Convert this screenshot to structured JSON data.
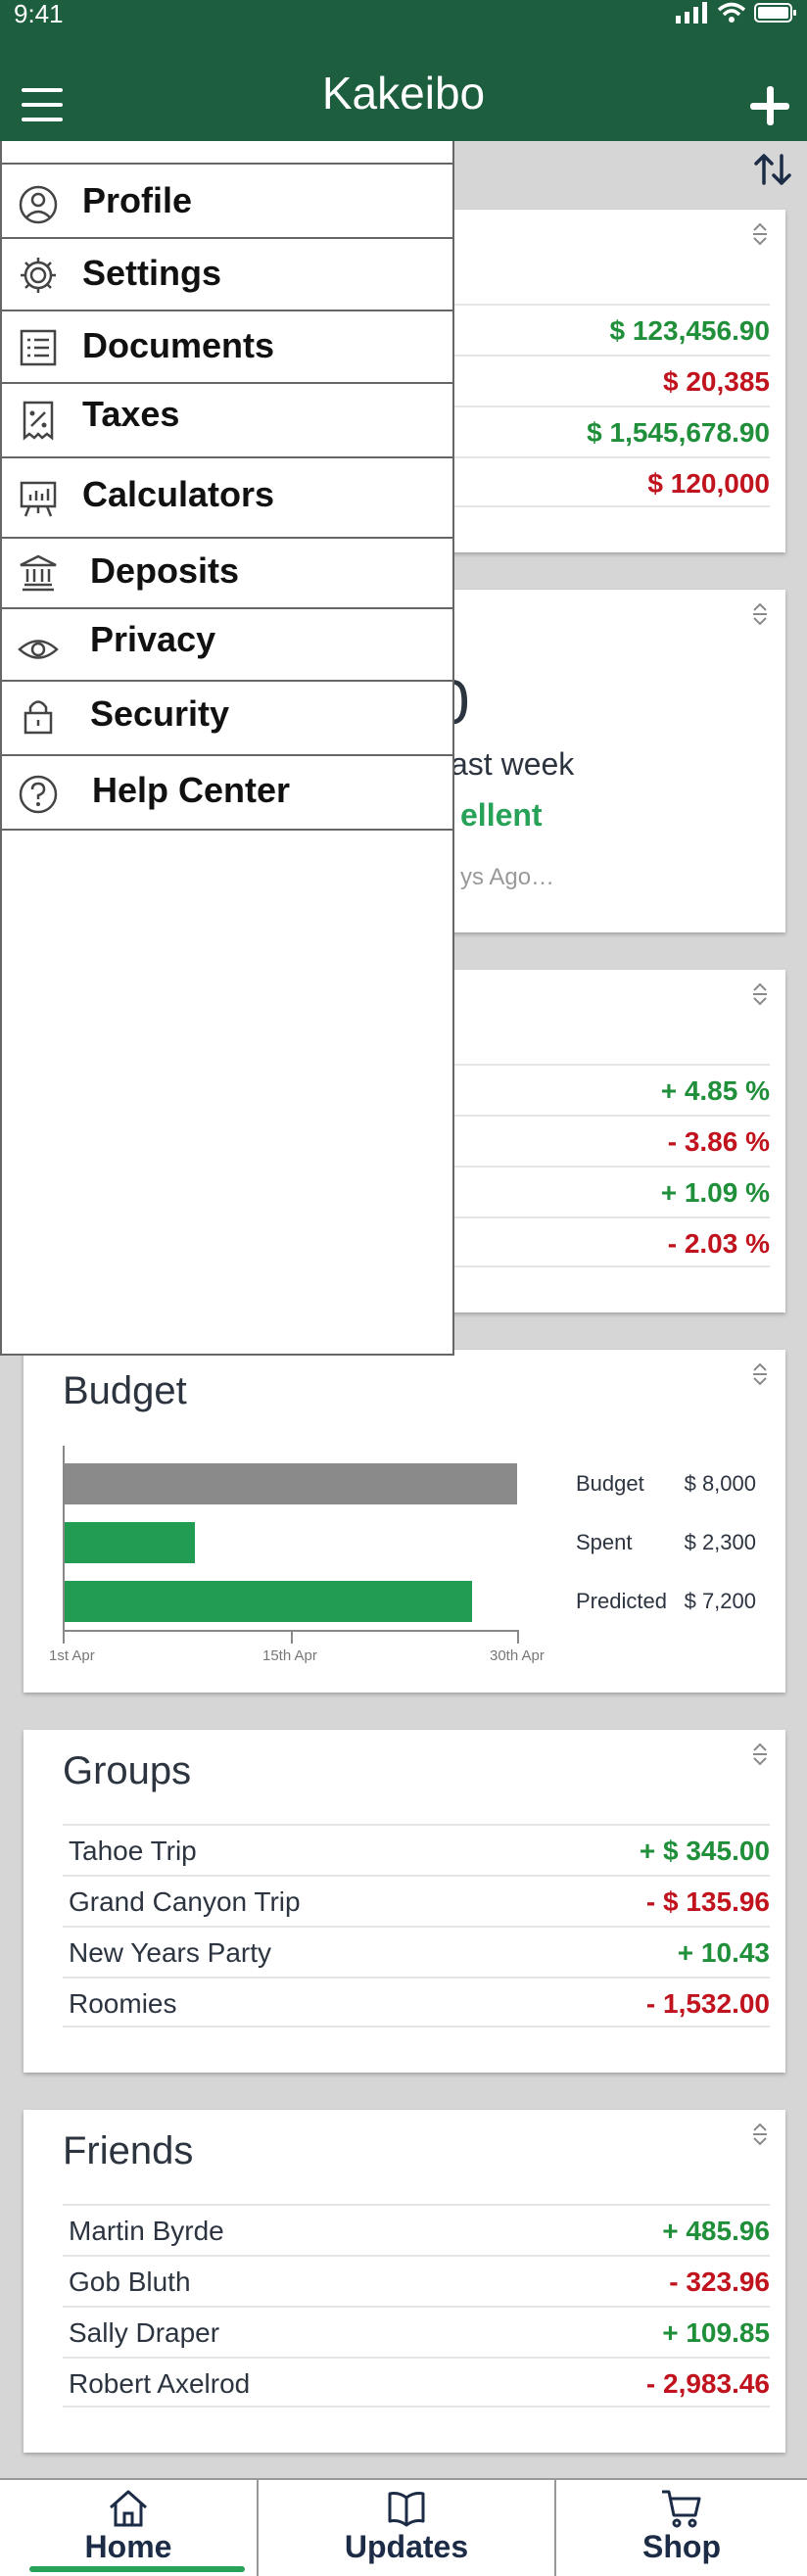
{
  "status_bar": {
    "time": "9:41"
  },
  "header": {
    "title": "Kakeibo"
  },
  "menu": {
    "items": [
      {
        "label": "Profile",
        "icon": "user-circle-icon"
      },
      {
        "label": "Settings",
        "icon": "gear-icon"
      },
      {
        "label": "Documents",
        "icon": "list-document-icon"
      },
      {
        "label": "Taxes",
        "icon": "receipt-percent-icon"
      },
      {
        "label": "Calculators",
        "icon": "chart-board-icon"
      },
      {
        "label": "Deposits",
        "icon": "bank-icon"
      },
      {
        "label": "Privacy",
        "icon": "eye-icon"
      },
      {
        "label": "Security",
        "icon": "lock-icon"
      },
      {
        "label": "Help Center",
        "icon": "question-circle-icon"
      }
    ]
  },
  "accounts_card": {
    "values": [
      "$ 123,456.90",
      "$ 20,385",
      "$ 1,545,678.90",
      "$ 120,000"
    ]
  },
  "score_card": {
    "partial_digit": "0",
    "partial_week": "ast week",
    "partial_rating": "ellent",
    "partial_time": "ys Ago…"
  },
  "markets_card": {
    "values": [
      "+ 4.85 %",
      "- 3.86 %",
      "+ 1.09 %",
      "- 2.03 %"
    ]
  },
  "budget_card": {
    "title": "Budget",
    "legend": [
      {
        "label": "Budget",
        "value": "$ 8,000"
      },
      {
        "label": "Spent",
        "value": "$ 2,300"
      },
      {
        "label": "Predicted",
        "value": "$ 7,200"
      }
    ]
  },
  "chart_data": {
    "type": "bar",
    "orientation": "horizontal",
    "categories": [
      "Budget",
      "Spent",
      "Predicted"
    ],
    "values": [
      8000,
      2300,
      7200
    ],
    "xlim": [
      0,
      8000
    ],
    "x_tick_labels": [
      "1st Apr",
      "15th Apr",
      "30th Apr"
    ],
    "colors": [
      "#8a8a8a",
      "#239c53",
      "#239c53"
    ]
  },
  "groups_card": {
    "title": "Groups",
    "rows": [
      {
        "label": "Tahoe Trip",
        "value": "+ $ 345.00"
      },
      {
        "label": "Grand Canyon Trip",
        "value": "-  $ 135.96"
      },
      {
        "label": "New Years Party",
        "value": "+ 10.43"
      },
      {
        "label": "Roomies",
        "value": "- 1,532.00"
      }
    ]
  },
  "friends_card": {
    "title": "Friends",
    "rows": [
      {
        "label": "Martin Byrde",
        "value": "+ 485.96"
      },
      {
        "label": "Gob Bluth",
        "value": "- 323.96"
      },
      {
        "label": "Sally Draper",
        "value": "+ 109.85"
      },
      {
        "label": "Robert Axelrod",
        "value": "- 2,983.46"
      }
    ]
  },
  "tabs": [
    {
      "label": "Home",
      "icon": "home-icon"
    },
    {
      "label": "Updates",
      "icon": "book-icon"
    },
    {
      "label": "Shop",
      "icon": "cart-icon"
    }
  ],
  "colors": {
    "brand": "#1d5e3e",
    "positive": "#1f8f3a",
    "negative": "#c0131e",
    "accent": "#27a258"
  }
}
